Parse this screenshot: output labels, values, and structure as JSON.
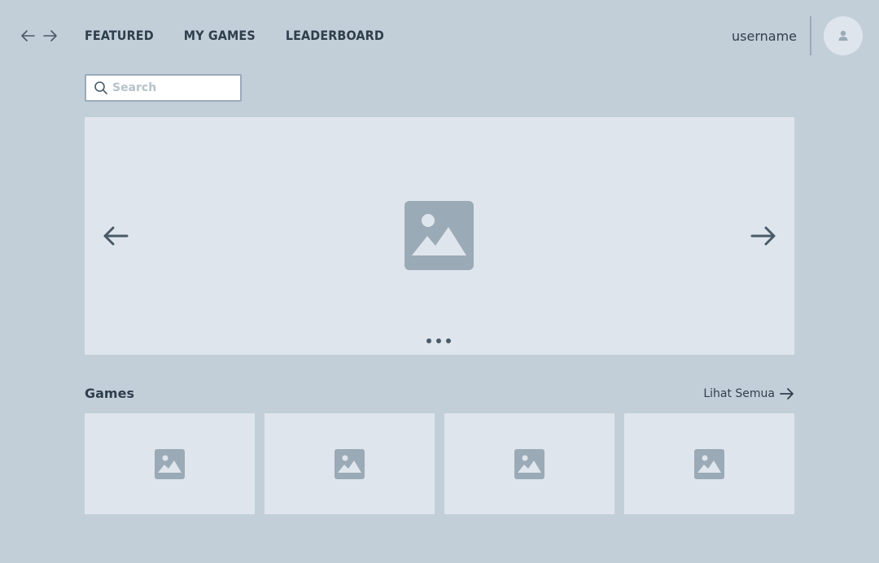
{
  "header": {
    "back_icon": "arrow-left-icon",
    "forward_icon": "arrow-right-icon",
    "tabs": [
      {
        "label": "FEATURED"
      },
      {
        "label": "MY GAMES"
      },
      {
        "label": "LEADERBOARD"
      }
    ],
    "username": "username",
    "avatar_icon": "user-icon"
  },
  "search": {
    "placeholder": "Search",
    "value": "",
    "icon": "search-icon"
  },
  "carousel": {
    "prev_icon": "arrow-left-icon",
    "next_icon": "arrow-right-icon",
    "image_icon": "image-placeholder-icon",
    "dot_count": 3
  },
  "games_section": {
    "title": "Games",
    "see_all_label": "Lihat Semua",
    "see_all_icon": "arrow-right-icon",
    "card_count": 4,
    "card_icon": "image-placeholder-icon"
  },
  "colors": {
    "background": "#c3cfd8",
    "panel": "#dfe5ec",
    "text": "#2f3f4d",
    "placeholder_image": "#9aaab6"
  }
}
